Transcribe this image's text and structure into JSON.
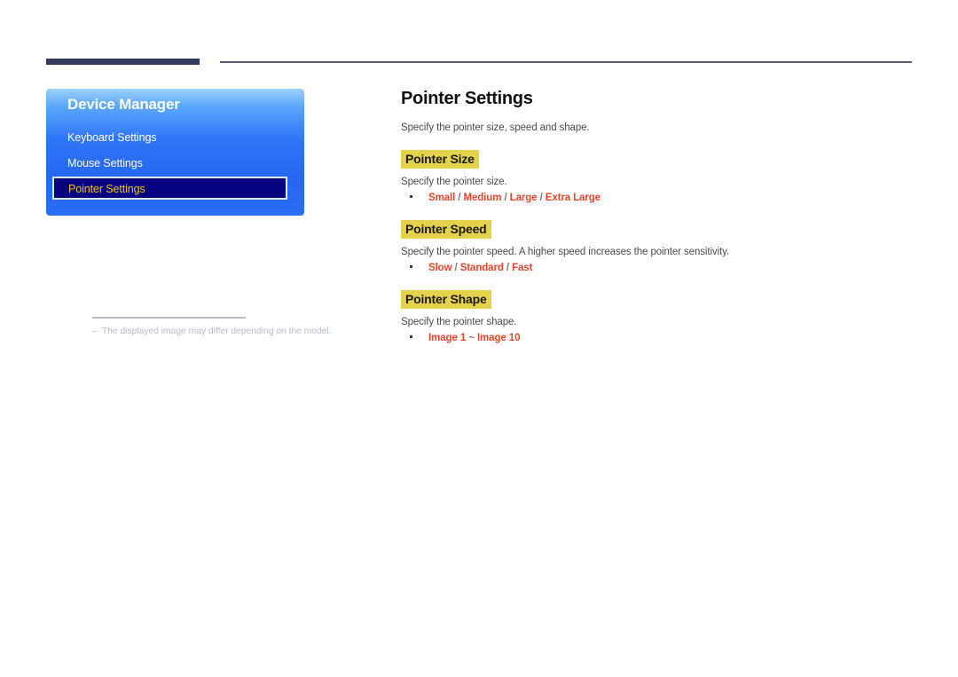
{
  "decor": {
    "rule_thick_color": "#333a5c",
    "rule_thin_color": "#555b77"
  },
  "osd": {
    "title": "Device Manager",
    "items": [
      {
        "label": "Keyboard Settings",
        "selected": false
      },
      {
        "label": "Mouse Settings",
        "selected": false
      },
      {
        "label": "Pointer Settings",
        "selected": true
      }
    ],
    "selected_text_color": "#f0c020",
    "panel_color": "#2667f0"
  },
  "note": {
    "marker": "–",
    "text": "The displayed image may differ depending on the model."
  },
  "page": {
    "title": "Pointer Settings",
    "lead": "Specify the pointer size, speed and shape.",
    "highlight_color": "#e5d24c",
    "option_color": "#e8442a",
    "sections": [
      {
        "title": "Pointer Size",
        "desc": "Specify the pointer size.",
        "options": [
          "Small",
          "Medium",
          "Large",
          "Extra Large"
        ],
        "separator": " / "
      },
      {
        "title": "Pointer Speed",
        "desc": "Specify the pointer speed. A higher speed increases the pointer sensitivity.",
        "options": [
          "Slow",
          "Standard",
          "Fast"
        ],
        "separator": " / "
      },
      {
        "title": "Pointer Shape",
        "desc": "Specify the pointer shape.",
        "options": [
          "Image 1",
          "Image 10"
        ],
        "separator": " ~ "
      }
    ]
  }
}
